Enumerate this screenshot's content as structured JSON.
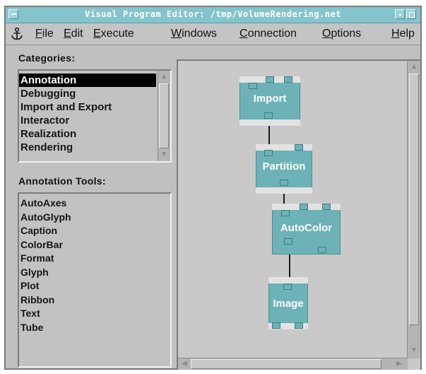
{
  "window": {
    "title": "Visual Program Editor: /tmp/VolumeRendering.net"
  },
  "menubar": {
    "icon": "anchor-icon",
    "items": [
      {
        "label": "File",
        "mnemonic": "F",
        "rest": "ile"
      },
      {
        "label": "Edit",
        "mnemonic": "E",
        "rest": "dit"
      },
      {
        "label": "Execute",
        "mnemonic": "E",
        "rest": "xecute"
      },
      {
        "label": "Windows",
        "mnemonic": "W",
        "rest": "indows"
      },
      {
        "label": "Connection",
        "mnemonic": "C",
        "rest": "onnection"
      },
      {
        "label": "Options",
        "mnemonic": "O",
        "rest": "ptions"
      },
      {
        "label": "Help",
        "mnemonic": "H",
        "rest": "elp"
      }
    ]
  },
  "categories": {
    "label": "Categories:",
    "selected": "Annotation",
    "items": [
      "Annotation",
      "Debugging",
      "Import and Export",
      "Interactor",
      "Realization",
      "Rendering"
    ]
  },
  "tools": {
    "label": "Annotation Tools:",
    "items": [
      "AutoAxes",
      "AutoGlyph",
      "Caption",
      "ColorBar",
      "Format",
      "Glyph",
      "Plot",
      "Ribbon",
      "Text",
      "Tube"
    ]
  },
  "network": {
    "modules": [
      {
        "name": "Import"
      },
      {
        "name": "Partition"
      },
      {
        "name": "AutoColor"
      },
      {
        "name": "Image"
      }
    ],
    "connections": [
      {
        "from": "Import",
        "to": "Partition"
      },
      {
        "from": "Partition",
        "to": "AutoColor"
      },
      {
        "from": "AutoColor",
        "to": "Image"
      }
    ]
  },
  "colors": {
    "titlebar": "#84c4cc",
    "module": "#6cb2b6",
    "panel": "#c0c0c0",
    "selection": "#000000"
  }
}
